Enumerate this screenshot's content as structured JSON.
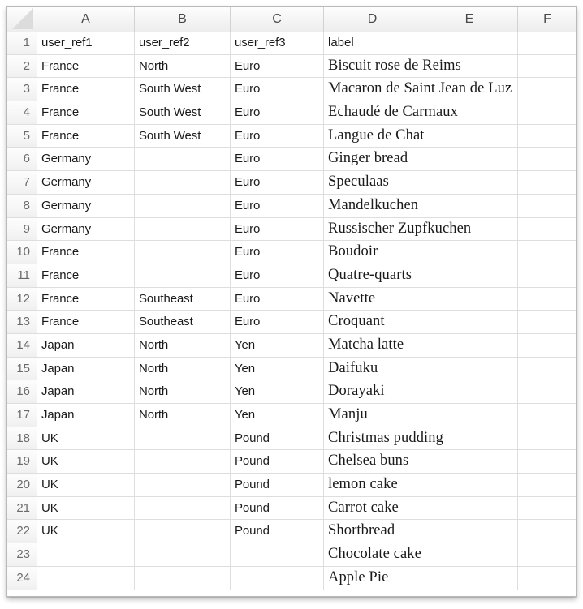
{
  "spreadsheet": {
    "corner": {
      "icon": "select-all-triangle"
    },
    "column_headers": [
      "A",
      "B",
      "C",
      "D",
      "E",
      "F"
    ],
    "row_numbers": [
      "1",
      "2",
      "3",
      "4",
      "5",
      "6",
      "7",
      "8",
      "9",
      "10",
      "11",
      "12",
      "13",
      "14",
      "15",
      "16",
      "17",
      "18",
      "19",
      "20",
      "21",
      "22",
      "23",
      "24"
    ],
    "header_row": {
      "A": "user_ref1",
      "B": "user_ref2",
      "C": "user_ref3",
      "D": "label",
      "E": "",
      "F": ""
    },
    "rows": [
      {
        "num": "2",
        "A": "France",
        "B": "North",
        "C": "Euro",
        "D": "Biscuit rose de Reims"
      },
      {
        "num": "3",
        "A": "France",
        "B": "South West",
        "C": "Euro",
        "D": "Macaron de Saint Jean de Luz"
      },
      {
        "num": "4",
        "A": "France",
        "B": "South West",
        "C": "Euro",
        "D": "Echaudé de Carmaux"
      },
      {
        "num": "5",
        "A": "France",
        "B": "South West",
        "C": "Euro",
        "D": "Langue de Chat"
      },
      {
        "num": "6",
        "A": "Germany",
        "B": "",
        "C": "Euro",
        "D": "Ginger bread"
      },
      {
        "num": "7",
        "A": "Germany",
        "B": "",
        "C": "Euro",
        "D": "Speculaas"
      },
      {
        "num": "8",
        "A": "Germany",
        "B": "",
        "C": "Euro",
        "D": "Mandelkuchen"
      },
      {
        "num": "9",
        "A": "Germany",
        "B": "",
        "C": "Euro",
        "D": "Russischer Zupfkuchen"
      },
      {
        "num": "10",
        "A": "France",
        "B": "",
        "C": "Euro",
        "D": "Boudoir"
      },
      {
        "num": "11",
        "A": "France",
        "B": "",
        "C": "Euro",
        "D": "Quatre-quarts"
      },
      {
        "num": "12",
        "A": "France",
        "B": "Southeast",
        "C": "Euro",
        "D": "Navette"
      },
      {
        "num": "13",
        "A": "France",
        "B": "Southeast",
        "C": "Euro",
        "D": "Croquant"
      },
      {
        "num": "14",
        "A": "Japan",
        "B": "North",
        "C": "Yen",
        "D": "Matcha latte"
      },
      {
        "num": "15",
        "A": "Japan",
        "B": "North",
        "C": "Yen",
        "D": "Daifuku"
      },
      {
        "num": "16",
        "A": "Japan",
        "B": "North",
        "C": "Yen",
        "D": "Dorayaki"
      },
      {
        "num": "17",
        "A": "Japan",
        "B": "North",
        "C": "Yen",
        "D": "Manju"
      },
      {
        "num": "18",
        "A": "UK",
        "B": "",
        "C": "Pound",
        "D": "Christmas pudding"
      },
      {
        "num": "19",
        "A": "UK",
        "B": "",
        "C": "Pound",
        "D": "Chelsea buns"
      },
      {
        "num": "20",
        "A": "UK",
        "B": "",
        "C": "Pound",
        "D": "lemon cake"
      },
      {
        "num": "21",
        "A": "UK",
        "B": "",
        "C": "Pound",
        "D": "Carrot cake"
      },
      {
        "num": "22",
        "A": "UK",
        "B": "",
        "C": "Pound",
        "D": "Shortbread"
      },
      {
        "num": "23",
        "A": "",
        "B": "",
        "C": "",
        "D": "Chocolate cake"
      },
      {
        "num": "24",
        "A": "",
        "B": "",
        "C": "",
        "D": "Apple Pie"
      }
    ]
  }
}
